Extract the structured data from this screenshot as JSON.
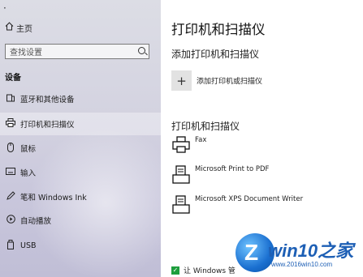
{
  "window": {
    "top_left_glyph": "·"
  },
  "sidebar": {
    "home_label": "主页",
    "search_placeholder": "查找设置",
    "section_title": "设备",
    "items": [
      {
        "label": "蓝牙和其他设备",
        "icon": "bluetooth-icon"
      },
      {
        "label": "打印机和扫描仪",
        "icon": "printer-icon",
        "active": true
      },
      {
        "label": "鼠标",
        "icon": "mouse-icon"
      },
      {
        "label": "输入",
        "icon": "keyboard-icon"
      },
      {
        "label": "笔和 Windows Ink",
        "icon": "pen-icon"
      },
      {
        "label": "自动播放",
        "icon": "autoplay-icon"
      },
      {
        "label": "USB",
        "icon": "usb-icon"
      }
    ]
  },
  "main": {
    "title": "打印机和扫描仪",
    "add_section_title": "添加打印机和扫描仪",
    "add_button_label": "添加打印机或扫描仪",
    "list_title": "打印机和扫描仪",
    "printers": [
      {
        "name": "Fax"
      },
      {
        "name": "Microsoft Print to PDF"
      },
      {
        "name": "Microsoft XPS Document Writer"
      }
    ],
    "checkbox_label": "让 Windows 管",
    "checkbox_checked": true
  },
  "watermark": {
    "logo_letter": "Z",
    "title": "win10之家",
    "url": "www.2016win10.com"
  },
  "colors": {
    "accent": "#1e9e3d",
    "watermark_blue": "#1d5fb5"
  }
}
